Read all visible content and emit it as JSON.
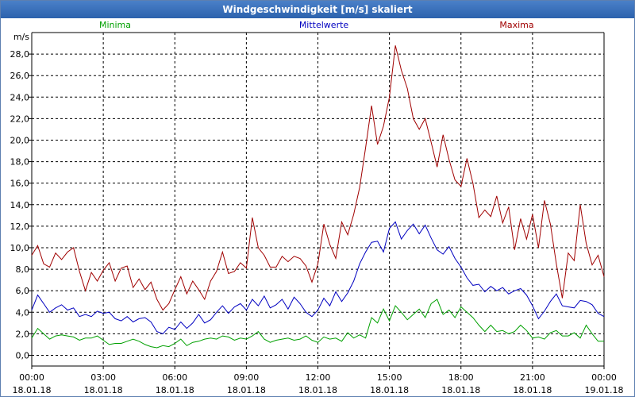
{
  "window": {
    "title": "Windgeschwindigkeit [m/s] skaliert"
  },
  "chart_data": {
    "type": "line",
    "title": "Windgeschwindigkeit [m/s] skaliert",
    "ylabel": "m/s",
    "ylim": [
      -1.0,
      30.0
    ],
    "yticks": [
      "0,0",
      "2,0",
      "4,0",
      "6,0",
      "8,0",
      "10,0",
      "12,0",
      "14,0",
      "16,0",
      "18,0",
      "20,0",
      "22,0",
      "24,0",
      "26,0",
      "28,0"
    ],
    "xlim": [
      0,
      24
    ],
    "xticks": [
      {
        "time": "00:00",
        "date": "18.01.18"
      },
      {
        "time": "03:00",
        "date": "18.01.18"
      },
      {
        "time": "06:00",
        "date": "18.01.18"
      },
      {
        "time": "09:00",
        "date": "18.01.18"
      },
      {
        "time": "12:00",
        "date": "18.01.18"
      },
      {
        "time": "15:00",
        "date": "18.01.18"
      },
      {
        "time": "18:00",
        "date": "18.01.18"
      },
      {
        "time": "21:00",
        "date": "18.01.18"
      },
      {
        "time": "00:00",
        "date": "19.01.18"
      }
    ],
    "grid": true,
    "legend": "top",
    "series": [
      {
        "name": "Minima",
        "color": "#00a000",
        "points": [
          [
            0,
            1.6
          ],
          [
            0.25,
            2.5
          ],
          [
            0.5,
            2.0
          ],
          [
            0.75,
            1.5
          ],
          [
            1.0,
            1.8
          ],
          [
            1.25,
            1.9
          ],
          [
            1.5,
            1.8
          ],
          [
            1.75,
            1.7
          ],
          [
            2.0,
            1.4
          ],
          [
            2.25,
            1.6
          ],
          [
            2.5,
            1.6
          ],
          [
            2.75,
            1.8
          ],
          [
            3.0,
            1.4
          ],
          [
            3.25,
            1.0
          ],
          [
            3.5,
            1.1
          ],
          [
            3.75,
            1.1
          ],
          [
            4.0,
            1.3
          ],
          [
            4.25,
            1.5
          ],
          [
            4.5,
            1.3
          ],
          [
            4.75,
            1.0
          ],
          [
            5.0,
            0.8
          ],
          [
            5.25,
            0.7
          ],
          [
            5.5,
            0.9
          ],
          [
            5.75,
            0.8
          ],
          [
            6.0,
            1.1
          ],
          [
            6.25,
            1.5
          ],
          [
            6.5,
            0.9
          ],
          [
            6.75,
            1.2
          ],
          [
            7.0,
            1.3
          ],
          [
            7.25,
            1.5
          ],
          [
            7.5,
            1.6
          ],
          [
            7.75,
            1.5
          ],
          [
            8.0,
            1.8
          ],
          [
            8.25,
            1.7
          ],
          [
            8.5,
            1.4
          ],
          [
            8.75,
            1.6
          ],
          [
            9.0,
            1.5
          ],
          [
            9.25,
            1.8
          ],
          [
            9.5,
            2.2
          ],
          [
            9.75,
            1.5
          ],
          [
            10.0,
            1.2
          ],
          [
            10.25,
            1.4
          ],
          [
            10.5,
            1.5
          ],
          [
            10.75,
            1.6
          ],
          [
            11.0,
            1.4
          ],
          [
            11.25,
            1.5
          ],
          [
            11.5,
            1.8
          ],
          [
            11.75,
            1.4
          ],
          [
            12.0,
            1.2
          ],
          [
            12.25,
            1.7
          ],
          [
            12.5,
            1.5
          ],
          [
            12.75,
            1.6
          ],
          [
            13.0,
            1.3
          ],
          [
            13.25,
            2.1
          ],
          [
            13.5,
            1.6
          ],
          [
            13.75,
            1.9
          ],
          [
            14.0,
            1.6
          ],
          [
            14.25,
            3.5
          ],
          [
            14.5,
            3.0
          ],
          [
            14.75,
            4.3
          ],
          [
            15.0,
            3.2
          ],
          [
            15.25,
            4.6
          ],
          [
            15.5,
            4.0
          ],
          [
            15.75,
            3.3
          ],
          [
            16.0,
            3.8
          ],
          [
            16.25,
            4.3
          ],
          [
            16.5,
            3.5
          ],
          [
            16.75,
            4.8
          ],
          [
            17.0,
            5.2
          ],
          [
            17.25,
            3.8
          ],
          [
            17.5,
            4.2
          ],
          [
            17.75,
            3.5
          ],
          [
            18.0,
            4.5
          ],
          [
            18.25,
            4.0
          ],
          [
            18.5,
            3.5
          ],
          [
            18.75,
            2.8
          ],
          [
            19.0,
            2.2
          ],
          [
            19.25,
            2.8
          ],
          [
            19.5,
            2.2
          ],
          [
            19.75,
            2.3
          ],
          [
            20.0,
            2.0
          ],
          [
            20.25,
            2.2
          ],
          [
            20.5,
            2.8
          ],
          [
            20.75,
            2.3
          ],
          [
            21.0,
            1.6
          ],
          [
            21.25,
            1.7
          ],
          [
            21.5,
            1.5
          ],
          [
            21.75,
            2.1
          ],
          [
            22.0,
            2.3
          ],
          [
            22.25,
            1.8
          ],
          [
            22.5,
            1.8
          ],
          [
            22.75,
            2.1
          ],
          [
            23.0,
            1.6
          ],
          [
            23.25,
            2.8
          ],
          [
            23.5,
            2.0
          ],
          [
            23.75,
            1.3
          ],
          [
            24.0,
            1.3
          ]
        ]
      },
      {
        "name": "Mittelwerte",
        "color": "#0000c0",
        "points": [
          [
            0,
            4.2
          ],
          [
            0.25,
            5.6
          ],
          [
            0.5,
            4.8
          ],
          [
            0.75,
            4.0
          ],
          [
            1.0,
            4.4
          ],
          [
            1.25,
            4.7
          ],
          [
            1.5,
            4.2
          ],
          [
            1.75,
            4.4
          ],
          [
            2.0,
            3.6
          ],
          [
            2.25,
            3.8
          ],
          [
            2.5,
            3.6
          ],
          [
            2.75,
            4.1
          ],
          [
            3.0,
            3.9
          ],
          [
            3.25,
            4.0
          ],
          [
            3.5,
            3.4
          ],
          [
            3.75,
            3.2
          ],
          [
            4.0,
            3.6
          ],
          [
            4.25,
            3.1
          ],
          [
            4.5,
            3.4
          ],
          [
            4.75,
            3.5
          ],
          [
            5.0,
            3.1
          ],
          [
            5.25,
            2.2
          ],
          [
            5.5,
            2.0
          ],
          [
            5.75,
            2.6
          ],
          [
            6.0,
            2.4
          ],
          [
            6.25,
            3.1
          ],
          [
            6.5,
            2.5
          ],
          [
            6.75,
            3.0
          ],
          [
            7.0,
            3.8
          ],
          [
            7.25,
            3.0
          ],
          [
            7.5,
            3.3
          ],
          [
            7.75,
            4.0
          ],
          [
            8.0,
            4.6
          ],
          [
            8.25,
            3.9
          ],
          [
            8.5,
            4.5
          ],
          [
            8.75,
            4.8
          ],
          [
            9.0,
            4.2
          ],
          [
            9.25,
            5.2
          ],
          [
            9.5,
            4.6
          ],
          [
            9.75,
            5.5
          ],
          [
            10.0,
            4.4
          ],
          [
            10.25,
            4.7
          ],
          [
            10.5,
            5.2
          ],
          [
            10.75,
            4.3
          ],
          [
            11.0,
            5.4
          ],
          [
            11.25,
            4.8
          ],
          [
            11.5,
            4.0
          ],
          [
            11.75,
            3.6
          ],
          [
            12.0,
            4.2
          ],
          [
            12.25,
            5.3
          ],
          [
            12.5,
            4.6
          ],
          [
            12.75,
            5.9
          ],
          [
            13.0,
            5.0
          ],
          [
            13.25,
            5.8
          ],
          [
            13.5,
            6.9
          ],
          [
            13.75,
            8.5
          ],
          [
            14.0,
            9.6
          ],
          [
            14.25,
            10.5
          ],
          [
            14.5,
            10.6
          ],
          [
            14.75,
            9.6
          ],
          [
            15.0,
            11.8
          ],
          [
            15.25,
            12.4
          ],
          [
            15.5,
            10.8
          ],
          [
            15.75,
            11.6
          ],
          [
            16.0,
            12.2
          ],
          [
            16.25,
            11.3
          ],
          [
            16.5,
            12.1
          ],
          [
            16.75,
            10.9
          ],
          [
            17.0,
            9.8
          ],
          [
            17.25,
            9.4
          ],
          [
            17.5,
            10.1
          ],
          [
            17.75,
            9.0
          ],
          [
            18.0,
            8.2
          ],
          [
            18.25,
            7.2
          ],
          [
            18.5,
            6.5
          ],
          [
            18.75,
            6.6
          ],
          [
            19.0,
            5.9
          ],
          [
            19.25,
            6.4
          ],
          [
            19.5,
            6.0
          ],
          [
            19.75,
            6.3
          ],
          [
            20.0,
            5.7
          ],
          [
            20.25,
            6.0
          ],
          [
            20.5,
            6.2
          ],
          [
            20.75,
            5.6
          ],
          [
            21.0,
            4.6
          ],
          [
            21.25,
            3.4
          ],
          [
            21.5,
            4.1
          ],
          [
            21.75,
            5.0
          ],
          [
            22.0,
            5.7
          ],
          [
            22.25,
            4.6
          ],
          [
            22.5,
            4.5
          ],
          [
            22.75,
            4.4
          ],
          [
            23.0,
            5.1
          ],
          [
            23.25,
            5.0
          ],
          [
            23.5,
            4.7
          ],
          [
            23.75,
            3.9
          ],
          [
            24.0,
            3.6
          ]
        ]
      },
      {
        "name": "Maxima",
        "color": "#a00000",
        "points": [
          [
            0,
            9.3
          ],
          [
            0.25,
            10.2
          ],
          [
            0.5,
            8.5
          ],
          [
            0.75,
            8.2
          ],
          [
            1.0,
            9.5
          ],
          [
            1.25,
            8.9
          ],
          [
            1.5,
            9.6
          ],
          [
            1.75,
            10.0
          ],
          [
            2.0,
            7.8
          ],
          [
            2.25,
            6.0
          ],
          [
            2.5,
            7.7
          ],
          [
            2.75,
            6.9
          ],
          [
            3.0,
            7.9
          ],
          [
            3.25,
            8.6
          ],
          [
            3.5,
            6.9
          ],
          [
            3.75,
            8.1
          ],
          [
            4.0,
            8.3
          ],
          [
            4.25,
            6.3
          ],
          [
            4.5,
            7.1
          ],
          [
            4.75,
            6.1
          ],
          [
            5.0,
            6.8
          ],
          [
            5.25,
            5.2
          ],
          [
            5.5,
            4.2
          ],
          [
            5.75,
            4.8
          ],
          [
            6.0,
            6.1
          ],
          [
            6.25,
            7.3
          ],
          [
            6.5,
            5.7
          ],
          [
            6.75,
            6.9
          ],
          [
            7.0,
            6.1
          ],
          [
            7.25,
            5.2
          ],
          [
            7.5,
            6.9
          ],
          [
            7.75,
            7.8
          ],
          [
            8.0,
            9.6
          ],
          [
            8.25,
            7.6
          ],
          [
            8.5,
            7.8
          ],
          [
            8.75,
            8.6
          ],
          [
            9.0,
            8.1
          ],
          [
            9.25,
            12.8
          ],
          [
            9.5,
            10.0
          ],
          [
            9.75,
            9.3
          ],
          [
            10.0,
            8.2
          ],
          [
            10.25,
            8.2
          ],
          [
            10.5,
            9.2
          ],
          [
            10.75,
            8.7
          ],
          [
            11.0,
            9.2
          ],
          [
            11.25,
            9.0
          ],
          [
            11.5,
            8.3
          ],
          [
            11.75,
            6.8
          ],
          [
            12.0,
            8.5
          ],
          [
            12.25,
            12.2
          ],
          [
            12.5,
            10.3
          ],
          [
            12.75,
            9.0
          ],
          [
            13.0,
            12.4
          ],
          [
            13.25,
            11.2
          ],
          [
            13.5,
            13.1
          ],
          [
            13.75,
            15.6
          ],
          [
            14.0,
            19.3
          ],
          [
            14.25,
            23.2
          ],
          [
            14.5,
            19.6
          ],
          [
            14.75,
            21.3
          ],
          [
            15.0,
            24.0
          ],
          [
            15.25,
            28.8
          ],
          [
            15.5,
            26.5
          ],
          [
            15.75,
            24.8
          ],
          [
            16.0,
            22.0
          ],
          [
            16.25,
            21.0
          ],
          [
            16.5,
            22.0
          ],
          [
            16.75,
            19.8
          ],
          [
            17.0,
            17.5
          ],
          [
            17.25,
            20.5
          ],
          [
            17.5,
            18.2
          ],
          [
            17.75,
            16.3
          ],
          [
            18.0,
            15.7
          ],
          [
            18.25,
            18.3
          ],
          [
            18.5,
            16.0
          ],
          [
            18.75,
            12.8
          ],
          [
            19.0,
            13.5
          ],
          [
            19.25,
            12.9
          ],
          [
            19.5,
            14.8
          ],
          [
            19.75,
            12.3
          ],
          [
            20.0,
            13.8
          ],
          [
            20.25,
            9.8
          ],
          [
            20.5,
            12.7
          ],
          [
            20.75,
            10.8
          ],
          [
            21.0,
            13.1
          ],
          [
            21.25,
            10.0
          ],
          [
            21.5,
            14.4
          ],
          [
            21.75,
            12.2
          ],
          [
            22.0,
            8.5
          ],
          [
            22.25,
            5.3
          ],
          [
            22.5,
            9.5
          ],
          [
            22.75,
            8.8
          ],
          [
            23.0,
            14.0
          ],
          [
            23.25,
            10.4
          ],
          [
            23.5,
            8.4
          ],
          [
            23.75,
            9.3
          ],
          [
            24.0,
            7.3
          ]
        ]
      }
    ]
  }
}
